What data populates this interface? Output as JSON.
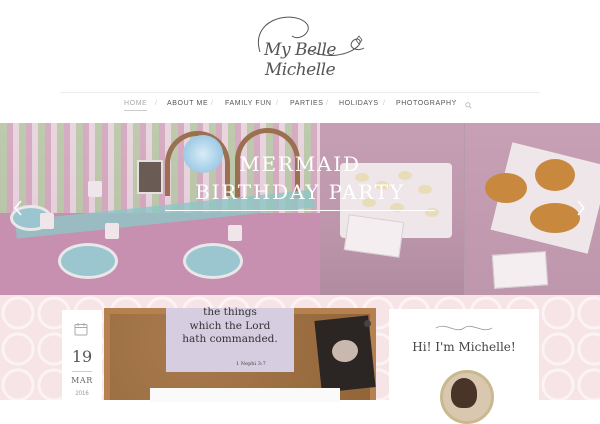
{
  "site": {
    "logo_text": "My Belle Michelle"
  },
  "nav": {
    "items": [
      {
        "label": "HOME",
        "active": true
      },
      {
        "label": "ABOUT ME"
      },
      {
        "label": "FAMILY FUN"
      },
      {
        "label": "PARTIES"
      },
      {
        "label": "HOLIDAYS"
      },
      {
        "label": "PHOTOGRAPHY"
      }
    ],
    "separator": "/",
    "search_icon": "search-icon"
  },
  "slider": {
    "title_line1": "MERMAID",
    "title_line2": "BIRTHDAY PARTY",
    "prev_icon": "chevron-left-icon",
    "next_icon": "chevron-right-icon"
  },
  "post": {
    "date_day": "19",
    "date_month": "MAR",
    "date_year": "2016",
    "calendar_icon": "calendar-icon",
    "note_lines": [
      "the things",
      "which the Lord",
      "hath commanded."
    ],
    "note_verse": "1 Nephi 3:7"
  },
  "sidebar": {
    "greeting": "Hi! I'm Michelle!"
  },
  "colors": {
    "accent": "#c7a0b5",
    "nav_text": "#555555",
    "pattern": "#f6e4e6"
  }
}
